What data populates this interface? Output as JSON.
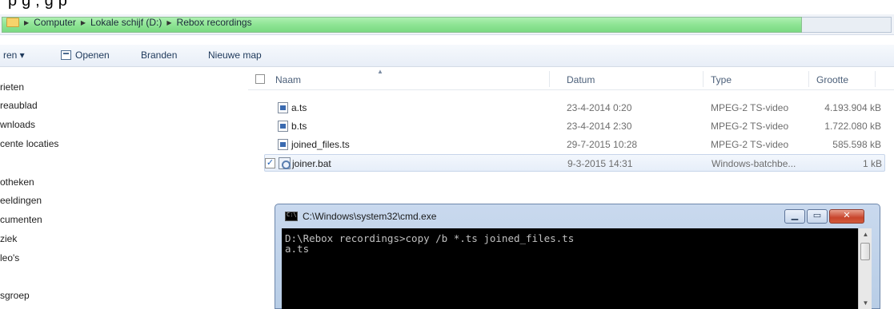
{
  "top_text": "p                                                                                  g                                    , g     p",
  "address": {
    "crumbs": [
      "Computer",
      "Lokale schijf (D:)",
      "Rebox recordings"
    ]
  },
  "toolbar": {
    "organize_label": "ren ▾",
    "open_label": "Openen",
    "burn_label": "Branden",
    "new_folder_label": "Nieuwe map"
  },
  "nav": {
    "items": [
      "rieten",
      "reaublad",
      "wnloads",
      "cente locaties",
      "otheken",
      "eeldingen",
      "cumenten",
      "ziek",
      "leo's",
      "sgroep"
    ]
  },
  "columns": {
    "name": "Naam",
    "date": "Datum",
    "type": "Type",
    "size": "Grootte"
  },
  "files": [
    {
      "name": "a.ts",
      "date": "23-4-2014 0:20",
      "type": "MPEG-2 TS-video",
      "size": "4.193.904 kB"
    },
    {
      "name": "b.ts",
      "date": "23-4-2014 2:30",
      "type": "MPEG-2 TS-video",
      "size": "1.722.080 kB"
    },
    {
      "name": "joined_files.ts",
      "date": "29-7-2015 10:28",
      "type": "MPEG-2 TS-video",
      "size": "585.598 kB"
    },
    {
      "name": "joiner.bat",
      "date": "9-3-2015 14:31",
      "type": "Windows-batchbe...",
      "size": "1 kB"
    }
  ],
  "cmd": {
    "title": "C:\\Windows\\system32\\cmd.exe",
    "lines": "D:\\Rebox recordings>copy /b *.ts joined_files.ts\na.ts"
  }
}
